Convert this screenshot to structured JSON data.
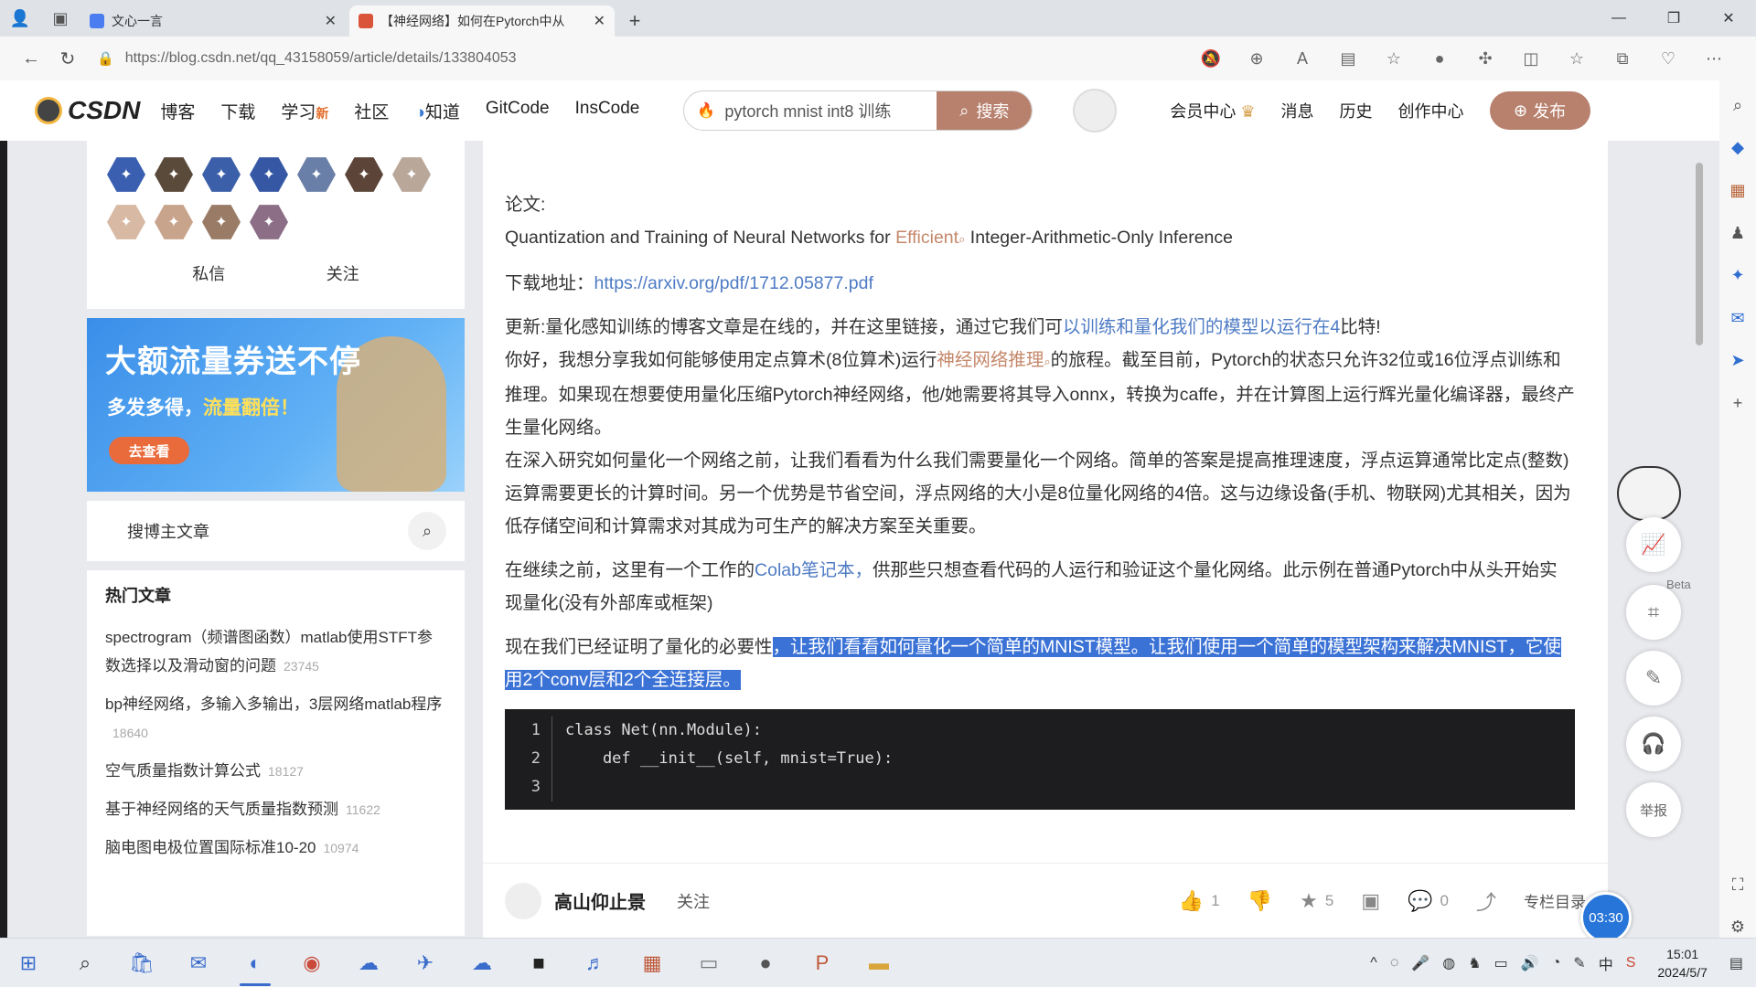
{
  "browser": {
    "tabs": [
      {
        "title": "文心一言",
        "active": false
      },
      {
        "title": "【神经网络】如何在Pytorch中从",
        "active": true
      }
    ],
    "url": "https://blog.csdn.net/qq_43158059/article/details/133804053"
  },
  "header": {
    "logo": "CSDN",
    "nav": [
      "博客",
      "下载",
      "学习",
      "社区",
      "知道",
      "GitCode",
      "InsCode"
    ],
    "nav_new_badge": "新",
    "search_query": "pytorch mnist int8 训练",
    "search_button": "搜索",
    "right_links": [
      "会员中心",
      "消息",
      "历史",
      "创作中心"
    ],
    "publish_button": "发布"
  },
  "sidebar": {
    "badges": [
      {
        "icon": "rocket-badge-icon",
        "color": "#3a5fb0"
      },
      {
        "icon": "graduate-badge-icon",
        "color": "#5a4a3a"
      },
      {
        "icon": "rocket-badge-icon",
        "color": "#3b5fa8"
      },
      {
        "icon": "rocket-badge-icon",
        "color": "#3658a4"
      },
      {
        "icon": "star-badge-icon",
        "color": "#6a7fa8"
      },
      {
        "icon": "medal-badge-icon",
        "color": "#5c4438"
      },
      {
        "icon": "github-badge-icon",
        "color": "#b9a79a"
      },
      {
        "icon": "book-badge-icon",
        "color": "#d7b9a4"
      },
      {
        "icon": "deer-badge-icon",
        "color": "#c9a48d"
      },
      {
        "icon": "pen-badge-icon",
        "color": "#9a7b66"
      },
      {
        "icon": "chat-badge-icon",
        "color": "#8c6f86"
      }
    ],
    "message_label": "私信",
    "follow_label": "关注",
    "banner": {
      "title": "大额流量券送不停",
      "subtitle_prefix": "多发多得，",
      "subtitle_highlight": "流量翻倍！",
      "button": "去查看"
    },
    "search_placeholder": "搜博主文章",
    "hot_title": "热门文章",
    "hot_articles": [
      {
        "title": "spectrogram（频谱图函数）matlab使用STFT参数选择以及滑动窗的问题",
        "views": "23745"
      },
      {
        "title": "bp神经网络，多输入多输出，3层网络matlab程序",
        "views": "18640"
      },
      {
        "title": "空气质量指数计算公式",
        "views": "18127"
      },
      {
        "title": "基于神经网络的天气质量指数预测",
        "views": "11622"
      },
      {
        "title": "脑电图电极位置国际标准10-20",
        "views": "10974"
      }
    ]
  },
  "article": {
    "paper_label": "论文:",
    "paper_title_prefix": "Quantization and Training of Neural Networks for",
    "paper_title_link": "Efficient",
    "paper_title_suffix": "Integer-Arithmetic-Only Inference",
    "download_label": "下载地址：",
    "download_link": "https://arxiv.org/pdf/1712.05877.pdf",
    "p1_prefix": "更新:量化感知训练的博客文章是在线的，并在这里链接，通过它我们可",
    "p1_link": "以训练和量化我们的模型以运行在4",
    "p1_suffix": "比特!",
    "p2_prefix": "你好，我想分享我如何能够使用定点算术(8位算术)运行",
    "p2_link": "神经网络推理",
    "p2_suffix": "的旅程。截至目前，Pytorch的状态只允许32位或16位浮点训练和推理。如果现在想要使用量化压缩Pytorch神经网络，他/她需要将其导入onnx，转换为caffe，并在计算图上运行辉光量化编译器，最终产生量化网络。",
    "p3": "在深入研究如何量化一个网络之前，让我们看看为什么我们需要量化一个网络。简单的答案是提高推理速度，浮点运算通常比定点(整数)运算需要更长的计算时间。另一个优势是节省空间，浮点网络的大小是8位量化网络的4倍。这与边缘设备(手机、物联网)尤其相关，因为低存储空间和计算需求对其成为可生产的解决方案至关重要。",
    "p4_prefix": "在继续之前，这里有一个工作的",
    "p4_link": "Colab笔记本，",
    "p4_suffix": "供那些只想查看代码的人运行和验证这个量化网络。此示例在普通Pytorch中从头开始实现量化(没有外部库或框架)",
    "p5_prefix": "现在我们已经证明了量化的必要性",
    "p5_selected": "，让我们看看如何量化一个简单的MNIST模型。让我们使用一个简单的模型架构来解决MNIST，它使用2个conv层和2个全连接层。",
    "code_lines": [
      {
        "n": "1",
        "text": "class Net(nn.Module):"
      },
      {
        "n": "2",
        "text": "    def __init__(self, mnist=True):"
      },
      {
        "n": "3",
        "text": ""
      }
    ]
  },
  "footer": {
    "author": "高山仰止景",
    "follow": "关注",
    "likes": "1",
    "favorites": "5",
    "comments": "0",
    "catalog": "专栏目录",
    "timer": "03:30"
  },
  "float_tools": {
    "beta": "Beta",
    "report": "举报"
  },
  "taskbar": {
    "time": "15:01",
    "date": "2024/5/7"
  }
}
